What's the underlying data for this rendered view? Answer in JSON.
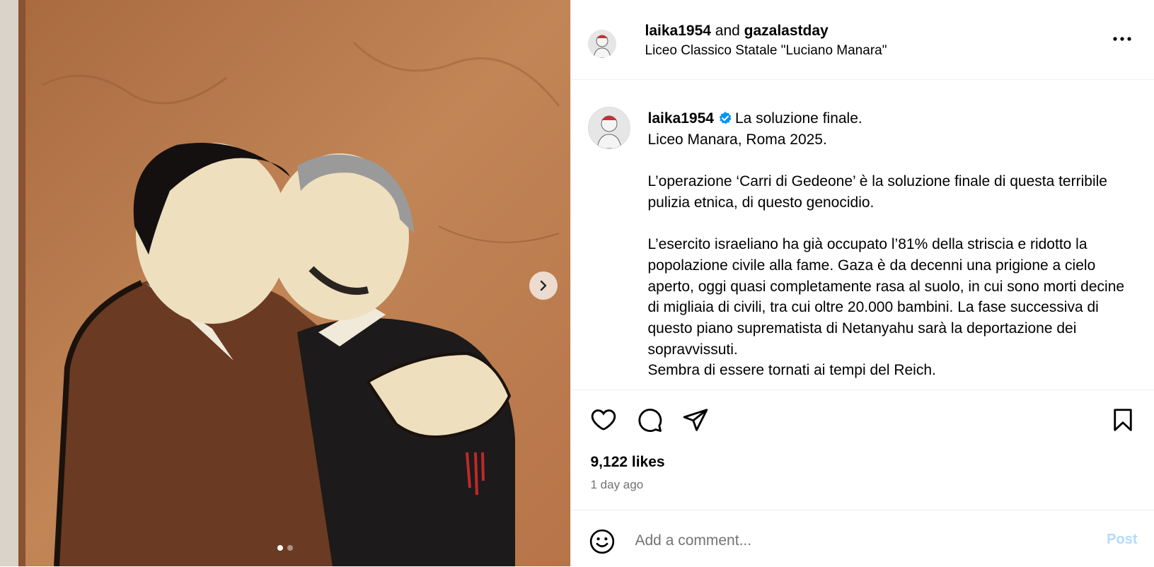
{
  "header": {
    "author": "laika1954",
    "joiner": " and ",
    "coauthor": "gazalastday",
    "location": "Liceo Classico Statale \"Luciano Manara\"",
    "more_icon": "more-horizontal-icon"
  },
  "caption": {
    "username": "laika1954",
    "verified_icon": "verified-badge-icon",
    "text": "La soluzione finale.\nLiceo Manara, Roma 2025.\n\nL’operazione ‘Carri di Gedeone’ è la soluzione finale di questa terribile pulizia etnica, di questo genocidio.\n\nL’esercito israeliano ha già occupato l’81% della striscia e ridotto la popolazione civile alla fame. Gaza è da decenni una prigione a cielo aperto, oggi quasi completamente rasa al suolo, in cui sono morti decine di migliaia di civili, tra cui oltre 20.000 bambini. La fase successiva di questo piano suprematista di Netanyahu sarà la deportazione dei sopravvissuti.\nSembra di essere tornati ai tempi del Reich."
  },
  "actions": {
    "like_icon": "heart-icon",
    "comment_icon": "comment-bubble-icon",
    "share_icon": "paper-plane-icon",
    "save_icon": "bookmark-icon"
  },
  "stats": {
    "likes": "9,122 likes",
    "time": "1 day ago"
  },
  "comment": {
    "placeholder": "Add a comment...",
    "post_label": "Post",
    "emoji_icon": "smiley-icon"
  },
  "carousel": {
    "current": 1,
    "total": 2,
    "next_icon": "chevron-right-icon"
  },
  "colors": {
    "wall": "#b97a4f",
    "link_disabled": "#b3dbff",
    "verified": "#0095f6",
    "muted": "#737373"
  }
}
